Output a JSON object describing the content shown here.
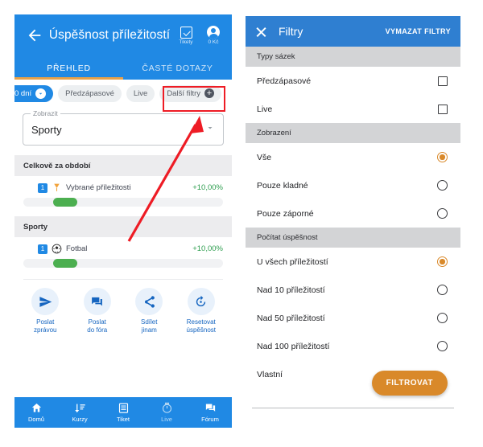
{
  "left": {
    "appbar": {
      "back_icon": "back-arrow-icon",
      "title": "Úspěšnost příležitostí",
      "tickets": {
        "icon": "ticket-icon",
        "label": "Tikety"
      },
      "account": {
        "icon": "account-circle-icon",
        "label": "0 Kč"
      }
    },
    "tabs": [
      {
        "label": "PŘEHLED",
        "active": true
      },
      {
        "label": "ČASTÉ DOTAZY",
        "active": false
      }
    ],
    "chips": [
      {
        "label": "0 dní",
        "type": "primary",
        "icon": "chevron-down-icon"
      },
      {
        "label": "Předzápasové",
        "type": "default"
      },
      {
        "label": "Live",
        "type": "default"
      },
      {
        "label": "Další filtry",
        "type": "default",
        "icon": "plus-circle-icon",
        "highlighted": true
      }
    ],
    "select": {
      "label": "Zobrazit",
      "value": "Sporty",
      "caret_icon": "dropdown-caret-icon"
    },
    "sections": [
      {
        "header": "Celkově za období",
        "rows": [
          {
            "rank": "1",
            "icon": "award-icon",
            "name": "Vybrané příležitosti",
            "value": "+10,00%",
            "bar_start_pct": 15,
            "bar_width_pct": 12
          }
        ]
      },
      {
        "header": "Sporty",
        "rows": [
          {
            "rank": "1",
            "icon": "soccer-ball-icon",
            "name": "Fotbal",
            "value": "+10,00%",
            "bar_start_pct": 15,
            "bar_width_pct": 12
          }
        ]
      }
    ],
    "actions": [
      {
        "icon": "send-icon",
        "line1": "Poslat",
        "line2": "zprávou"
      },
      {
        "icon": "forum-icon",
        "line1": "Poslat",
        "line2": "do fóra"
      },
      {
        "icon": "share-icon",
        "line1": "Sdílet",
        "line2": "jinam"
      },
      {
        "icon": "restore-icon",
        "line1": "Resetovat",
        "line2": "úspěšnost"
      }
    ],
    "bottom_nav": [
      {
        "icon": "home-icon",
        "label": "Domů",
        "active": true
      },
      {
        "icon": "sort-odds-icon",
        "label": "Kurzy",
        "active": true
      },
      {
        "icon": "ticket-list-icon",
        "label": "Tiket",
        "active": true
      },
      {
        "icon": "timer-icon",
        "label": "Live",
        "active": false
      },
      {
        "icon": "forum-icon",
        "label": "Fórum",
        "active": true
      }
    ]
  },
  "right": {
    "appbar": {
      "close_icon": "close-icon",
      "title": "Filtry",
      "clear_label": "VYMAZAT FILTRY"
    },
    "groups": [
      {
        "header": "Typy sázek",
        "control": "checkbox",
        "options": [
          {
            "label": "Předzápasové",
            "checked": false
          },
          {
            "label": "Live",
            "checked": false
          }
        ]
      },
      {
        "header": "Zobrazení",
        "control": "radio",
        "options": [
          {
            "label": "Vše",
            "checked": true
          },
          {
            "label": "Pouze kladné",
            "checked": false
          },
          {
            "label": "Pouze záporné",
            "checked": false
          }
        ]
      },
      {
        "header": "Počítat úspěšnost",
        "control": "radio",
        "options": [
          {
            "label": "U všech příležitostí",
            "checked": true
          },
          {
            "label": "Nad 10 příležitostí",
            "checked": false
          },
          {
            "label": "Nad 50 příležitostí",
            "checked": false
          },
          {
            "label": "Nad 100 příležitostí",
            "checked": false
          },
          {
            "label": "Vlastní",
            "checked": null
          }
        ]
      }
    ],
    "filter_button": "FILTROVAT"
  },
  "colors": {
    "primary_blue": "#2089e4",
    "filter_blue": "#2f7fd1",
    "accent_orange": "#d9892a",
    "tab_indicator": "#e6a14a",
    "positive_green": "#2e9e4f",
    "bar_green": "#4caf50",
    "highlight_red": "#ee1c25",
    "group_header_gray": "#d3d4d6",
    "section_header_gray": "#ececee"
  }
}
